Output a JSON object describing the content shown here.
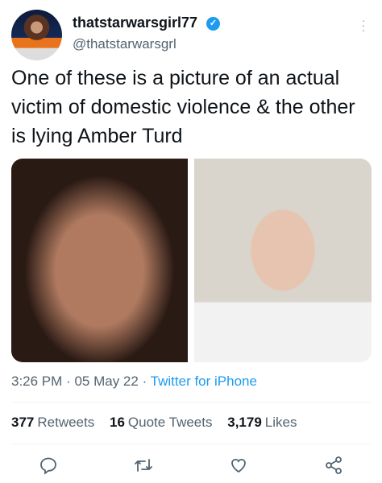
{
  "author": {
    "name": "thatstarwarsgirl77",
    "handle": "@thatstarwarsgrl",
    "verified": true
  },
  "tweet": {
    "text": "One of these is a picture of an actual victim of domestic violence & the other is lying Amber Turd"
  },
  "meta": {
    "time": "3:26 PM",
    "date": "05 May 22",
    "separator": "·",
    "source": "Twitter for iPhone"
  },
  "stats": {
    "retweets": "377",
    "retweets_label": "Retweets",
    "quotes": "16",
    "quotes_label": "Quote Tweets",
    "likes": "3,179",
    "likes_label": "Likes"
  },
  "colors": {
    "accent": "#1d9bf0",
    "secondary": "#536471"
  }
}
